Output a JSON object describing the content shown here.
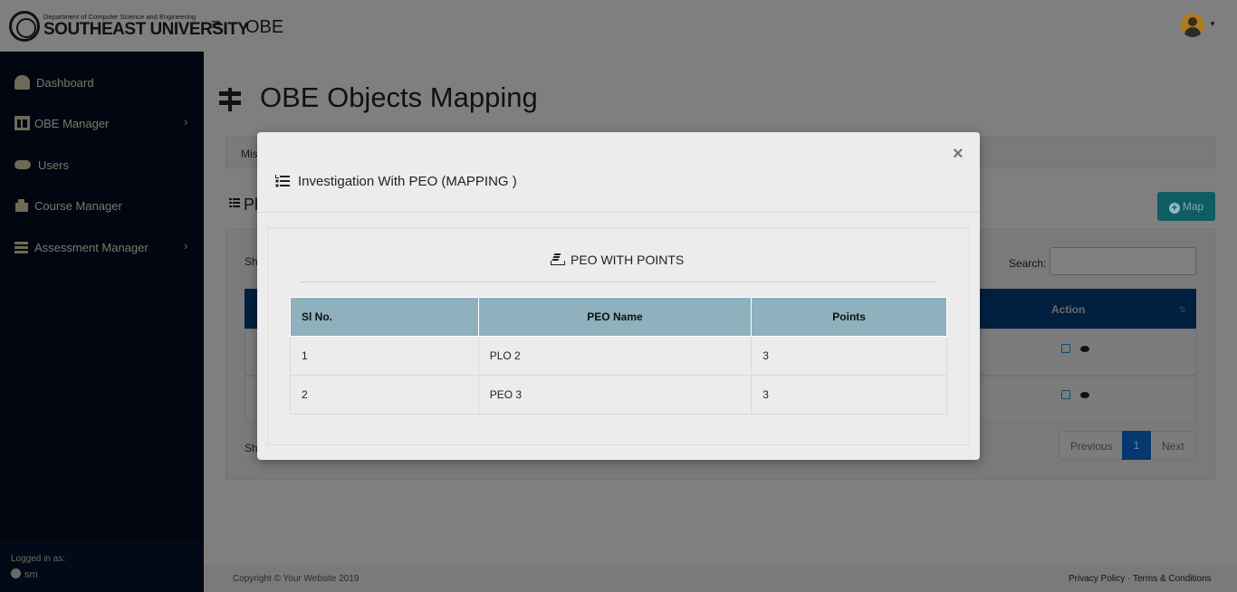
{
  "header": {
    "logo_small": "Department of Computer Science and Engineering",
    "logo_big": "SOUTHEAST UNIVERSITY",
    "app_title": "OBE"
  },
  "sidebar": {
    "items": [
      {
        "label": "Dashboard",
        "icon": "tachometer-icon",
        "has_arrow": false
      },
      {
        "label": "OBE Manager",
        "icon": "table-icon",
        "has_arrow": true
      },
      {
        "label": "Users",
        "icon": "users-icon",
        "has_arrow": false
      },
      {
        "label": "Course Manager",
        "icon": "boxes-icon",
        "has_arrow": false
      },
      {
        "label": "Assessment Manager",
        "icon": "bars-icon",
        "has_arrow": true
      }
    ],
    "logged_in_label": "Logged in as:",
    "logged_in_user": "sm"
  },
  "page": {
    "title": "OBE Objects Mapping",
    "tab_partial": "Mis",
    "section_partial": "Pl",
    "map_button": "Map",
    "show_partial": "Sh",
    "showing_partial": "Sh",
    "search_label": "Search:",
    "table_action_header": "Action",
    "pagination": {
      "previous": "Previous",
      "page": "1",
      "next": "Next"
    }
  },
  "modal": {
    "close_symbol": "×",
    "title": "Investigation With PEO (MAPPING )",
    "section_title": "PEO WITH POINTS",
    "columns": [
      "Sl No.",
      "PEO Name",
      "Points"
    ],
    "rows": [
      {
        "sl": "1",
        "name": "PLO 2",
        "points": "3"
      },
      {
        "sl": "2",
        "name": "PEO 3",
        "points": "3"
      }
    ]
  },
  "footer": {
    "copyright": "Copyright © Your Website 2019",
    "links": "Privacy Policy · Terms & Conditions"
  },
  "colors": {
    "sidebar_bg": "#010611",
    "overlay_gray": "#7f7f7f",
    "table_header": "#8eb1bd",
    "map_button": "#0f5c62",
    "active_page": "#04386e"
  }
}
